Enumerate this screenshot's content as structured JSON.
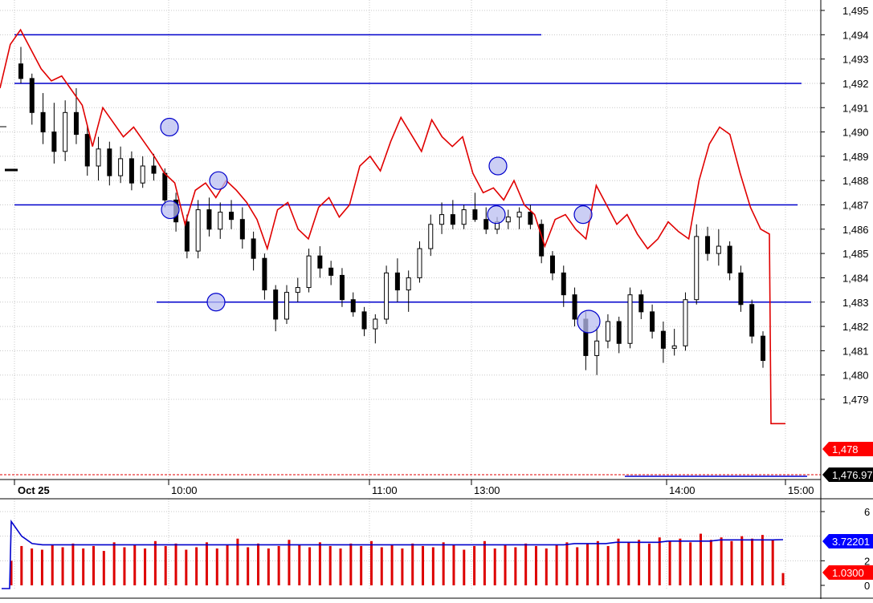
{
  "colors": {
    "price_bar": "#000000",
    "red_line": "#e00000",
    "hline": "#0000cc",
    "marker_fill": "#b9bdf0",
    "marker_stroke": "#0000cc",
    "grid": "#c8c8c8",
    "volume_bar": "#dd0000",
    "volume_avg": "#0000cc",
    "last_price_badge": "#ff0000",
    "secondary_badge": "#000000",
    "volume_avg_badge": "#0000ff"
  },
  "chart_data": [
    {
      "type": "candlestick",
      "title": "",
      "xlabel": "",
      "ylabel": "",
      "ylim": [
        1477.6,
        1495.5
      ],
      "grid": true,
      "y_ticks": [
        "1,495",
        "1,494",
        "1,493",
        "1,492",
        "1,491",
        "1,490",
        "1,489",
        "1,488",
        "1,487",
        "1,486",
        "1,485",
        "1,484",
        "1,483",
        "1,482",
        "1,481",
        "1,480",
        "1,479"
      ],
      "x_ticks": [
        "Oct 25",
        "10:00",
        "11:00",
        "13:00",
        "14:00",
        "15:00"
      ],
      "last_price_label": "1,478",
      "secondary_price_label": "1,476.97",
      "price_series": [
        {
          "o": 1492.8,
          "h": 1493.5,
          "l": 1492.0,
          "c": 1492.2
        },
        {
          "o": 1492.2,
          "h": 1492.4,
          "l": 1490.3,
          "c": 1490.8
        },
        {
          "o": 1490.8,
          "h": 1491.6,
          "l": 1489.5,
          "c": 1490.0
        },
        {
          "o": 1490.0,
          "h": 1491.2,
          "l": 1488.7,
          "c": 1489.2
        },
        {
          "o": 1489.2,
          "h": 1491.3,
          "l": 1488.8,
          "c": 1490.8
        },
        {
          "o": 1490.8,
          "h": 1491.8,
          "l": 1489.5,
          "c": 1489.9
        },
        {
          "o": 1489.9,
          "h": 1490.3,
          "l": 1488.2,
          "c": 1488.6
        },
        {
          "o": 1488.6,
          "h": 1489.8,
          "l": 1488.0,
          "c": 1489.3
        },
        {
          "o": 1489.3,
          "h": 1489.6,
          "l": 1487.8,
          "c": 1488.2
        },
        {
          "o": 1488.2,
          "h": 1489.4,
          "l": 1487.9,
          "c": 1488.9
        },
        {
          "o": 1488.9,
          "h": 1489.2,
          "l": 1487.6,
          "c": 1487.9
        },
        {
          "o": 1487.9,
          "h": 1489.0,
          "l": 1487.7,
          "c": 1488.6
        },
        {
          "o": 1488.6,
          "h": 1489.1,
          "l": 1488.0,
          "c": 1488.3
        },
        {
          "o": 1488.3,
          "h": 1488.5,
          "l": 1486.9,
          "c": 1487.2
        },
        {
          "o": 1487.2,
          "h": 1487.5,
          "l": 1485.9,
          "c": 1486.3
        },
        {
          "o": 1486.3,
          "h": 1486.6,
          "l": 1484.8,
          "c": 1485.1
        },
        {
          "o": 1485.1,
          "h": 1487.2,
          "l": 1484.8,
          "c": 1486.8
        },
        {
          "o": 1486.8,
          "h": 1487.3,
          "l": 1485.7,
          "c": 1486.0
        },
        {
          "o": 1486.0,
          "h": 1487.1,
          "l": 1485.6,
          "c": 1486.7
        },
        {
          "o": 1486.7,
          "h": 1487.2,
          "l": 1486.0,
          "c": 1486.4
        },
        {
          "o": 1486.4,
          "h": 1486.9,
          "l": 1485.2,
          "c": 1485.6
        },
        {
          "o": 1485.6,
          "h": 1485.9,
          "l": 1484.3,
          "c": 1484.8
        },
        {
          "o": 1484.8,
          "h": 1485.0,
          "l": 1483.1,
          "c": 1483.5
        },
        {
          "o": 1483.5,
          "h": 1483.7,
          "l": 1481.8,
          "c": 1482.3
        },
        {
          "o": 1482.3,
          "h": 1483.7,
          "l": 1482.1,
          "c": 1483.4
        },
        {
          "o": 1483.4,
          "h": 1484.0,
          "l": 1483.0,
          "c": 1483.6
        },
        {
          "o": 1483.6,
          "h": 1485.2,
          "l": 1483.4,
          "c": 1484.9
        },
        {
          "o": 1484.9,
          "h": 1485.3,
          "l": 1484.0,
          "c": 1484.4
        },
        {
          "o": 1484.4,
          "h": 1484.7,
          "l": 1483.7,
          "c": 1484.1
        },
        {
          "o": 1484.1,
          "h": 1484.4,
          "l": 1482.8,
          "c": 1483.1
        },
        {
          "o": 1483.1,
          "h": 1483.4,
          "l": 1482.4,
          "c": 1482.6
        },
        {
          "o": 1482.6,
          "h": 1482.8,
          "l": 1481.6,
          "c": 1481.9
        },
        {
          "o": 1481.9,
          "h": 1482.5,
          "l": 1481.3,
          "c": 1482.3
        },
        {
          "o": 1482.3,
          "h": 1484.5,
          "l": 1482.1,
          "c": 1484.2
        },
        {
          "o": 1484.2,
          "h": 1484.8,
          "l": 1483.0,
          "c": 1483.5
        },
        {
          "o": 1483.5,
          "h": 1484.3,
          "l": 1482.6,
          "c": 1484.0
        },
        {
          "o": 1484.0,
          "h": 1485.5,
          "l": 1483.8,
          "c": 1485.2
        },
        {
          "o": 1485.2,
          "h": 1486.6,
          "l": 1484.9,
          "c": 1486.2
        },
        {
          "o": 1486.2,
          "h": 1487.1,
          "l": 1485.8,
          "c": 1486.6
        },
        {
          "o": 1486.6,
          "h": 1487.2,
          "l": 1486.0,
          "c": 1486.2
        },
        {
          "o": 1486.2,
          "h": 1487.0,
          "l": 1486.0,
          "c": 1486.8
        },
        {
          "o": 1486.8,
          "h": 1487.5,
          "l": 1486.3,
          "c": 1486.4
        },
        {
          "o": 1486.4,
          "h": 1486.9,
          "l": 1485.8,
          "c": 1486.0
        },
        {
          "o": 1486.0,
          "h": 1486.5,
          "l": 1485.8,
          "c": 1486.3
        },
        {
          "o": 1486.3,
          "h": 1486.8,
          "l": 1486.0,
          "c": 1486.5
        },
        {
          "o": 1486.5,
          "h": 1486.9,
          "l": 1486.0,
          "c": 1486.7
        },
        {
          "o": 1486.7,
          "h": 1487.0,
          "l": 1486.0,
          "c": 1486.2
        },
        {
          "o": 1486.2,
          "h": 1486.4,
          "l": 1484.6,
          "c": 1484.9
        },
        {
          "o": 1484.9,
          "h": 1485.1,
          "l": 1483.9,
          "c": 1484.2
        },
        {
          "o": 1484.2,
          "h": 1484.5,
          "l": 1482.8,
          "c": 1483.3
        },
        {
          "o": 1483.3,
          "h": 1483.6,
          "l": 1482.0,
          "c": 1482.3
        },
        {
          "o": 1482.3,
          "h": 1482.6,
          "l": 1480.2,
          "c": 1480.8
        },
        {
          "o": 1480.8,
          "h": 1482.0,
          "l": 1480.0,
          "c": 1481.4
        },
        {
          "o": 1481.4,
          "h": 1482.5,
          "l": 1481.1,
          "c": 1482.2
        },
        {
          "o": 1482.2,
          "h": 1482.4,
          "l": 1480.9,
          "c": 1481.3
        },
        {
          "o": 1481.3,
          "h": 1483.6,
          "l": 1481.1,
          "c": 1483.3
        },
        {
          "o": 1483.3,
          "h": 1483.5,
          "l": 1482.3,
          "c": 1482.6
        },
        {
          "o": 1482.6,
          "h": 1482.9,
          "l": 1481.5,
          "c": 1481.8
        },
        {
          "o": 1481.8,
          "h": 1482.2,
          "l": 1480.5,
          "c": 1481.1
        },
        {
          "o": 1481.1,
          "h": 1481.9,
          "l": 1480.8,
          "c": 1481.2
        },
        {
          "o": 1481.2,
          "h": 1483.4,
          "l": 1481.0,
          "c": 1483.1
        },
        {
          "o": 1483.1,
          "h": 1486.2,
          "l": 1482.9,
          "c": 1485.7
        },
        {
          "o": 1485.7,
          "h": 1486.1,
          "l": 1484.7,
          "c": 1485.0
        },
        {
          "o": 1485.0,
          "h": 1486.0,
          "l": 1484.5,
          "c": 1485.3
        },
        {
          "o": 1485.3,
          "h": 1485.5,
          "l": 1483.9,
          "c": 1484.2
        },
        {
          "o": 1484.2,
          "h": 1484.5,
          "l": 1482.6,
          "c": 1482.9
        },
        {
          "o": 1482.9,
          "h": 1483.1,
          "l": 1481.3,
          "c": 1481.6
        },
        {
          "o": 1481.6,
          "h": 1481.8,
          "l": 1480.3,
          "c": 1480.6
        }
      ]
    },
    {
      "type": "line",
      "title": "",
      "xlabel": "",
      "ylabel": "",
      "series": [
        {
          "values": [
            1491.8,
            1493.6,
            1494.2,
            1493.4,
            1492.6,
            1492.1,
            1492.3,
            1491.7,
            1491.1,
            1489.4,
            1491.0,
            1490.4,
            1489.8,
            1490.2,
            1489.6,
            1489.0,
            1488.3,
            1487.9,
            1486.2,
            1487.6,
            1487.9,
            1487.3,
            1488.0,
            1487.6,
            1487.1,
            1486.4,
            1485.2,
            1486.8,
            1487.1,
            1486.0,
            1485.6,
            1486.9,
            1487.3,
            1486.5,
            1487.0,
            1488.6,
            1489.0,
            1488.4,
            1489.6,
            1490.6,
            1489.9,
            1489.2,
            1490.5,
            1489.8,
            1489.4,
            1489.8,
            1488.3,
            1487.5,
            1487.7,
            1487.2,
            1488.0,
            1487.0,
            1486.6,
            1485.3,
            1486.4,
            1486.6,
            1486.0,
            1485.6,
            1487.8,
            1487.0,
            1486.2,
            1486.6,
            1485.8,
            1485.2,
            1485.6,
            1486.3,
            1485.9,
            1485.6,
            1488.0,
            1489.5,
            1490.2,
            1489.9,
            1488.3,
            1486.9,
            1486.0,
            1485.8,
            1478.0
          ]
        }
      ]
    },
    {
      "type": "bar",
      "title": "",
      "xlabel": "",
      "ylabel": "",
      "ylim": [
        0,
        7
      ],
      "y_ticks": [
        "6",
        "2",
        "0"
      ],
      "average_label": "3.72201",
      "last_label": "1.0300",
      "series": [
        {
          "values": [
            2.0,
            3.2,
            3.0,
            2.9,
            3.3,
            3.1,
            3.4,
            3.0,
            3.2,
            2.8,
            3.5,
            3.1,
            3.3,
            3.0,
            3.6,
            3.2,
            3.4,
            2.9,
            3.1,
            3.5,
            3.0,
            3.3,
            3.8,
            3.1,
            3.4,
            3.0,
            3.2,
            3.7,
            3.3,
            3.1,
            3.5,
            3.2,
            3.0,
            3.4,
            3.2,
            3.6,
            3.1,
            3.3,
            3.0,
            3.4,
            3.2,
            3.1,
            3.5,
            3.3,
            2.9,
            3.2,
            3.6,
            3.0,
            3.3,
            3.1,
            3.4,
            3.2,
            3.0,
            3.3,
            3.5,
            3.1,
            3.4,
            3.6,
            3.2,
            3.8,
            3.5,
            3.7,
            3.4,
            3.9,
            3.6,
            3.8,
            3.5,
            4.2,
            3.7,
            3.9,
            3.6,
            4.0,
            3.8,
            4.1,
            3.7,
            1.0
          ]
        },
        {
          "name": "",
          "values": [
            5.2,
            4.0,
            3.4,
            3.3,
            3.3,
            3.3,
            3.3,
            3.3,
            3.3,
            3.3,
            3.3,
            3.3,
            3.3,
            3.3,
            3.3,
            3.3,
            3.3,
            3.3,
            3.3,
            3.3,
            3.3,
            3.3,
            3.3,
            3.3,
            3.3,
            3.3,
            3.3,
            3.3,
            3.3,
            3.3,
            3.3,
            3.3,
            3.3,
            3.3,
            3.3,
            3.3,
            3.3,
            3.3,
            3.3,
            3.3,
            3.3,
            3.3,
            3.3,
            3.3,
            3.3,
            3.3,
            3.3,
            3.3,
            3.3,
            3.3,
            3.3,
            3.3,
            3.3,
            3.3,
            3.4,
            3.4,
            3.4,
            3.4,
            3.5,
            3.5,
            3.5,
            3.5,
            3.5,
            3.6,
            3.6,
            3.6,
            3.6,
            3.6,
            3.7,
            3.7,
            3.7,
            3.7,
            3.7,
            3.7,
            3.72
          ]
        }
      ]
    }
  ],
  "horizontal_levels": [
    1494.0,
    1492.0,
    1487.0,
    1483.0,
    1477.0
  ],
  "markers": [
    {
      "price": 1490.2,
      "series": "red"
    },
    {
      "price": 1488.0,
      "series": "red"
    },
    {
      "price": 1486.8,
      "series": "price"
    },
    {
      "price": 1483.0,
      "series": "price"
    },
    {
      "price": 1488.6,
      "series": "red"
    },
    {
      "price": 1486.6,
      "series": "price"
    },
    {
      "price": 1486.6,
      "series": "red"
    },
    {
      "price": 1482.2,
      "series": "price"
    }
  ]
}
